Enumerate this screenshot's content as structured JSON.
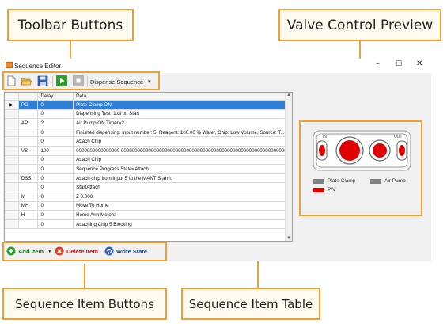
{
  "callouts": {
    "toolbar": "Toolbar Buttons",
    "valve": "Valve Control Preview",
    "sequence_item_buttons": "Sequence Item Buttons",
    "sequence_item_table": "Sequence Item Table"
  },
  "window": {
    "title": "Sequence Editor",
    "controls": {
      "minimize": "–",
      "maximize": "☐",
      "close": "✕"
    }
  },
  "toolbar": {
    "icons": [
      "new-file-icon",
      "open-folder-icon",
      "save-icon",
      "play-icon",
      "stop-icon"
    ],
    "dropdown_label": "Dispense Sequence",
    "dropdown_arrow": "▾"
  },
  "table": {
    "columns": [
      "",
      "Delay",
      "Data"
    ],
    "rows": [
      {
        "tag": "PC",
        "delay": "0",
        "data": "Plate Clamp ON",
        "selected": true
      },
      {
        "tag": "",
        "delay": "0",
        "data": "Dispensing Test_1.dl txt Start"
      },
      {
        "tag": "AP",
        "delay": "2",
        "data": "Air Pump ON Timer=2"
      },
      {
        "tag": "",
        "delay": "0",
        "data": "Finished dispensing. Input number: 5, Reagent: 100.00 % Water, Chip: Low Volume, Source: T..."
      },
      {
        "tag": "",
        "delay": "0",
        "data": "Attach Chip"
      },
      {
        "tag": "VS",
        "delay": "100",
        "data": "0000000000000000 0000000000000000000000000000000000000000000000000000000000000..."
      },
      {
        "tag": "",
        "delay": "0",
        "data": "Attach Chip"
      },
      {
        "tag": "",
        "delay": "0",
        "data": "Sequence Progress State=Attach"
      },
      {
        "tag": "DSSI",
        "delay": "0",
        "data": "Attach chip from input 5 to the MANTIS arm."
      },
      {
        "tag": "",
        "delay": "0",
        "data": "StartAttach"
      },
      {
        "tag": "M",
        "delay": "0",
        "data": "Z 0.000"
      },
      {
        "tag": "MH",
        "delay": "0",
        "data": "Move To Home"
      },
      {
        "tag": "H",
        "delay": "0",
        "data": "Home Arm Motors"
      },
      {
        "tag": "",
        "delay": "0",
        "data": "Attaching Chip 5 Blocking"
      }
    ]
  },
  "valve_preview": {
    "in_label": "IN",
    "out_label": "OUT",
    "legend": [
      {
        "label": "Plate Clamp",
        "color": "#808080"
      },
      {
        "label": "Air Pump",
        "color": "#808080"
      },
      {
        "label": "P/V",
        "color": "#e00000"
      }
    ]
  },
  "bottom_buttons": {
    "add": "Add Item",
    "add_arrow": "▾",
    "delete": "Delete Item",
    "write": "Write State"
  },
  "colors": {
    "accent_orange": "#f0a030",
    "selection_blue": "#2d7fd8",
    "valve_red": "#e00000"
  }
}
